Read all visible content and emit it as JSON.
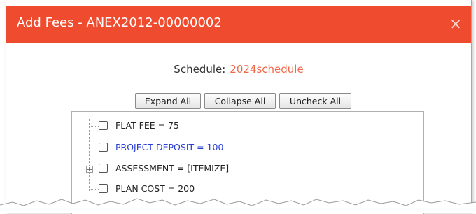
{
  "dialog": {
    "title": "Add Fees - ANEX2012-00000002",
    "close_glyph": "×",
    "close_icon": "close-icon",
    "accent_color": "#ef4b2e"
  },
  "schedule": {
    "label": "Schedule:",
    "value": "2024schedule",
    "value_color": "#ef6a4c"
  },
  "toolbar": {
    "expand_all": "Expand All",
    "collapse_all": "Collapse All",
    "uncheck_all": "Uncheck All"
  },
  "tree": {
    "items": [
      {
        "label": "FLAT FEE = 75",
        "checked": false,
        "expandable": false
      },
      {
        "label": "PROJECT DEPOSIT = 100",
        "checked": false,
        "expandable": false,
        "link_color": "#2a3fd6"
      },
      {
        "label": "ASSESSMENT = [ITEMIZE]",
        "checked": false,
        "expandable": true,
        "expander_icon": "plus-expander-icon"
      },
      {
        "label": "PLAN COST = 200",
        "checked": false,
        "expandable": false
      }
    ]
  }
}
